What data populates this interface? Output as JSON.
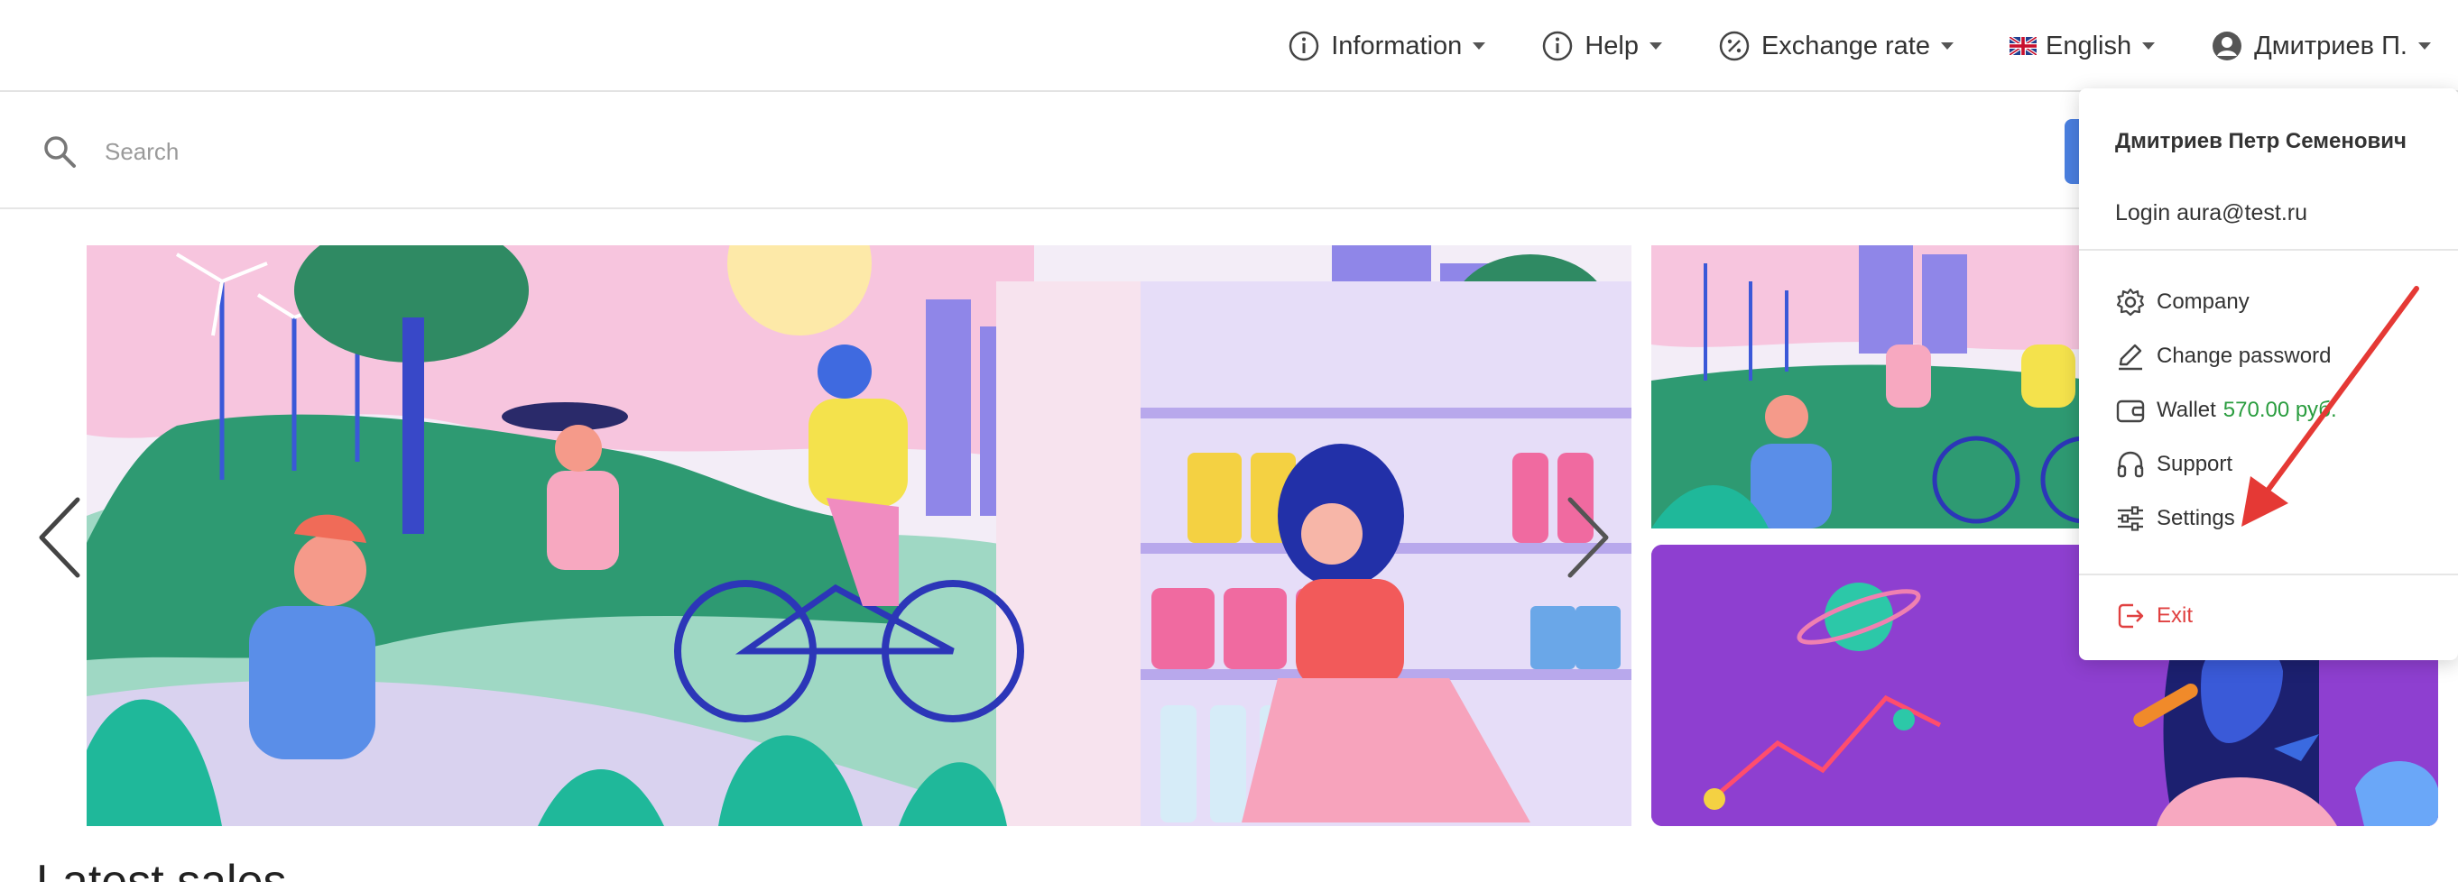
{
  "topnav": {
    "information": "Information",
    "help": "Help",
    "exchange_rate": "Exchange rate",
    "language": "English",
    "user_short": "Дмитриев П."
  },
  "search": {
    "placeholder": "Search"
  },
  "banner": {
    "prev_icon": "chevron-left-icon",
    "next_icon": "chevron-right-icon"
  },
  "section_heading_partial": "Latest sales",
  "user_menu": {
    "full_name": "Дмитриев Петр Семенович",
    "login": "Login aura@test.ru",
    "items": [
      {
        "label": "Company",
        "icon": "gear-icon"
      },
      {
        "label": "Change password",
        "icon": "pencil-icon"
      },
      {
        "label": "Wallet",
        "icon": "wallet-icon",
        "amount": "570.00 руб."
      },
      {
        "label": "Support",
        "icon": "headphones-icon"
      },
      {
        "label": "Settings",
        "icon": "sliders-icon"
      }
    ],
    "exit": "Exit"
  },
  "colors": {
    "accent": "#4a7fe0",
    "wallet_amount": "#2a9d3f",
    "exit": "#e04040",
    "annotation_arrow": "#e53935",
    "promo_background": "#8e3fd0"
  }
}
